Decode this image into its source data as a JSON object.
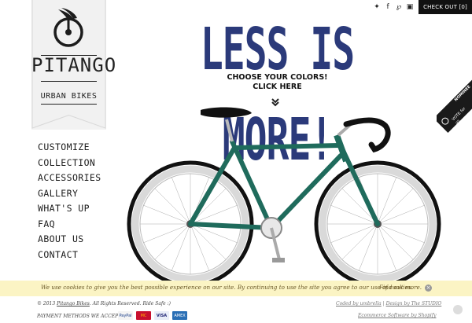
{
  "topbar": {
    "social": [
      {
        "icon": "twitter-icon",
        "glyph": "✦"
      },
      {
        "icon": "facebook-icon",
        "glyph": "f"
      },
      {
        "icon": "pinterest-icon",
        "glyph": "℘"
      },
      {
        "icon": "instagram-icon",
        "glyph": "▣"
      }
    ],
    "checkout_label": "CHECK OUT [0]"
  },
  "brand": {
    "name": "PITANGO",
    "tagline": "URBAN BIKES"
  },
  "nav": {
    "items": [
      {
        "label": "CUSTOMIZE"
      },
      {
        "label": "COLLECTION"
      },
      {
        "label": "ACCESSORIES"
      },
      {
        "label": "GALLERY"
      },
      {
        "label": "WHAT'S UP"
      },
      {
        "label": "FAQ"
      },
      {
        "label": "ABOUT US"
      },
      {
        "label": "CONTACT"
      }
    ]
  },
  "hero": {
    "headline": "LESS IS MORE!",
    "cta_line1": "CHOOSE YOUR COLORS!",
    "cta_line2": "CLICK HERE"
  },
  "badge": {
    "line1": "NOMINEE",
    "line2": "VOTE for us"
  },
  "cookie": {
    "text": "We use cookies to give you the best possible experience on our site. By continuing to use the site you agree to our use of cookies.",
    "link": "Find out more.",
    "close": "×"
  },
  "footer": {
    "copyright_prefix": "© 2013",
    "copyright_link": "Pitango Bikes",
    "copyright_suffix": ". All Rights Reserved. Ride Safe :)",
    "payment_label": "PAYMENT METHODS WE ACCEPT",
    "cards": [
      "PayPal",
      "MC",
      "VISA",
      "AMEX"
    ],
    "credit_a": "Coded by umbrella",
    "credit_sep": " | ",
    "credit_b": "Design by The STUDIO",
    "shopify": "Ecommerce Software by Shopify"
  },
  "colors": {
    "headline": "#2b3a7a",
    "frame": "#1f6b5c",
    "cookie_bg": "#fbf4c4",
    "checkout_bg": "#111111"
  }
}
